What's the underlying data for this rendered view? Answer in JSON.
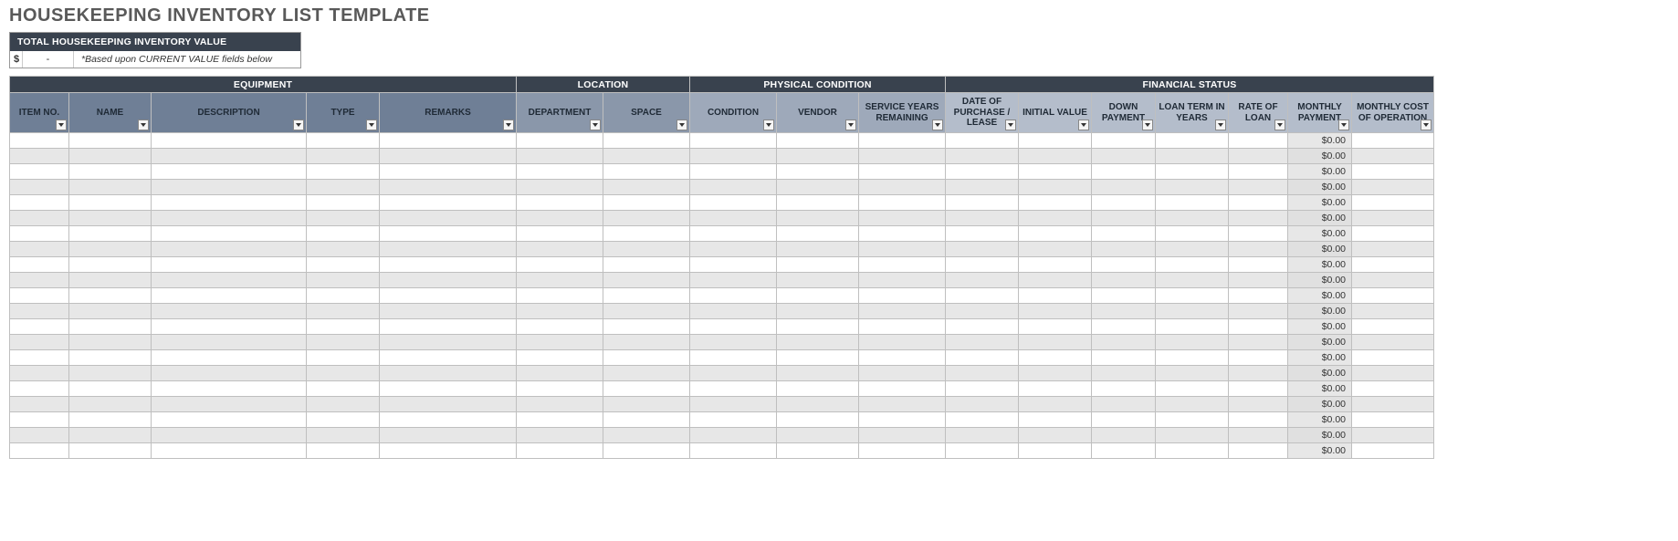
{
  "title": "HOUSEKEEPING INVENTORY LIST TEMPLATE",
  "total_box": {
    "header": "TOTAL HOUSEKEEPING INVENTORY VALUE",
    "currency": "$",
    "value": "-",
    "note": "*Based upon CURRENT VALUE fields below"
  },
  "groups": {
    "equipment": "EQUIPMENT",
    "location": "LOCATION",
    "physical": "PHYSICAL CONDITION",
    "financial": "FINANCIAL STATUS"
  },
  "columns": {
    "item_no": "ITEM NO.",
    "name": "NAME",
    "description": "DESCRIPTION",
    "type": "TYPE",
    "remarks": "REMARKS",
    "department": "DEPARTMENT",
    "space": "SPACE",
    "condition": "CONDITION",
    "vendor": "VENDOR",
    "service_years": "SERVICE YEARS REMAINING",
    "date_purchase": "DATE OF PURCHASE / LEASE",
    "initial_value": "INITIAL VALUE",
    "down_payment": "DOWN PAYMENT",
    "loan_term": "LOAN TERM IN YEARS",
    "rate": "RATE OF LOAN",
    "monthly_payment": "MONTHLY PAYMENT",
    "monthly_cost_op": "MONTHLY COST OF OPERATION"
  },
  "rows": [
    {
      "monthly_payment": "$0.00"
    },
    {
      "monthly_payment": "$0.00"
    },
    {
      "monthly_payment": "$0.00"
    },
    {
      "monthly_payment": "$0.00"
    },
    {
      "monthly_payment": "$0.00"
    },
    {
      "monthly_payment": "$0.00"
    },
    {
      "monthly_payment": "$0.00"
    },
    {
      "monthly_payment": "$0.00"
    },
    {
      "monthly_payment": "$0.00"
    },
    {
      "monthly_payment": "$0.00"
    },
    {
      "monthly_payment": "$0.00"
    },
    {
      "monthly_payment": "$0.00"
    },
    {
      "monthly_payment": "$0.00"
    },
    {
      "monthly_payment": "$0.00"
    },
    {
      "monthly_payment": "$0.00"
    },
    {
      "monthly_payment": "$0.00"
    },
    {
      "monthly_payment": "$0.00"
    },
    {
      "monthly_payment": "$0.00"
    },
    {
      "monthly_payment": "$0.00"
    },
    {
      "monthly_payment": "$0.00"
    },
    {
      "monthly_payment": "$0.00"
    }
  ]
}
